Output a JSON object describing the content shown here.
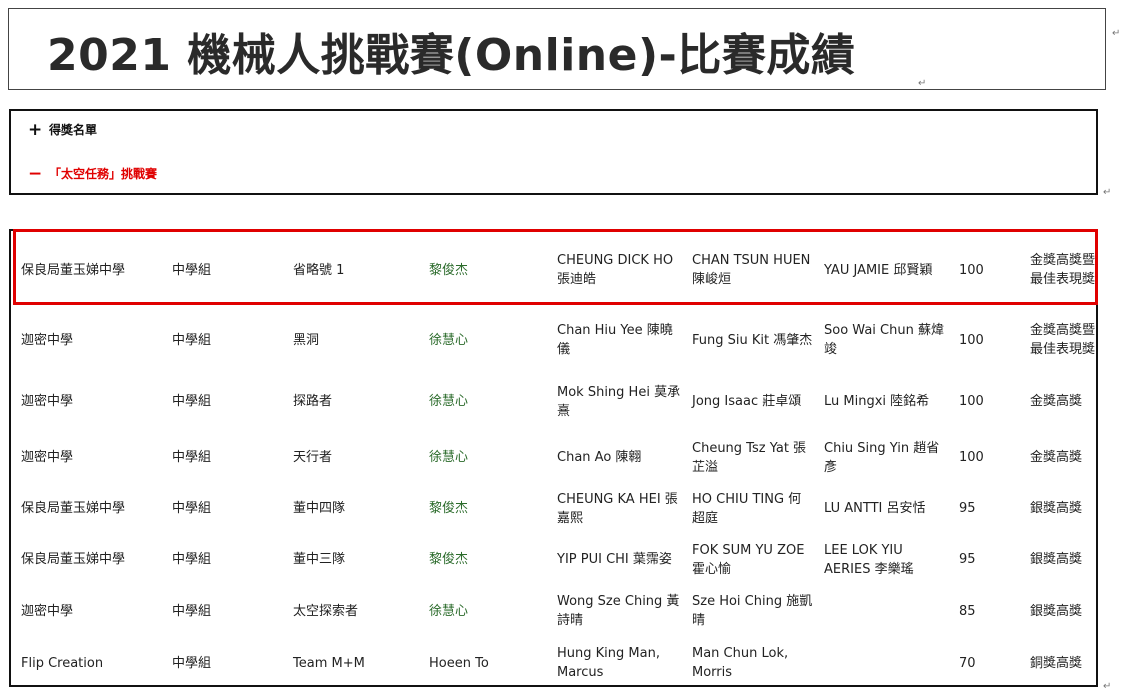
{
  "header": {
    "title": "2021 機械人挑戰賽(Online)-比賽成績",
    "para_mark": "↵"
  },
  "accordion": {
    "items": [
      {
        "sign": "+",
        "label": "得獎名單",
        "state": "collapsed"
      },
      {
        "sign": "−",
        "label": "「太空任務」挑戰賽",
        "state": "expanded",
        "color": "#e00000"
      }
    ]
  },
  "results_table": {
    "highlight_color": "#e00000",
    "rows": [
      {
        "school": "保良局董玉娣中學",
        "group": "中學組",
        "team": "省略號 1",
        "teacher": "黎俊杰",
        "member1": "CHEUNG DICK HO 張迪皓",
        "member2": "CHAN TSUN HUEN 陳峻烜",
        "member3": "YAU JAMIE 邱賢穎",
        "score": "100",
        "award": "金獎高獎暨 最佳表現獎"
      },
      {
        "school": "迦密中學",
        "group": "中學組",
        "team": "黑洞",
        "teacher": "徐慧心",
        "member1": "Chan Hiu Yee 陳曉儀",
        "member2": "Fung Siu Kit 馮肇杰",
        "member3": "Soo Wai Chun 蘇煒竣",
        "score": "100",
        "award": "金獎高獎暨 最佳表現獎"
      },
      {
        "school": "迦密中學",
        "group": "中學組",
        "team": "探路者",
        "teacher": "徐慧心",
        "member1": "Mok Shing Hei 莫承熹",
        "member2": "Jong Isaac 莊卓頌",
        "member3": "Lu Mingxi 陸銘希",
        "score": "100",
        "award": "金獎高獎"
      },
      {
        "school": "迦密中學",
        "group": "中學組",
        "team": "天行者",
        "teacher": "徐慧心",
        "member1": "Chan Ao 陳翱",
        "member2": "Cheung Tsz Yat 張芷溢",
        "member3": "Chiu Sing Yin 趙省彥",
        "score": "100",
        "award": "金獎高獎"
      },
      {
        "school": "保良局董玉娣中學",
        "group": "中學組",
        "team": "董中四隊",
        "teacher": "黎俊杰",
        "member1": "CHEUNG KA HEI 張嘉熙",
        "member2": "HO CHIU TING 何超庭",
        "member3": "LU ANTTI 呂安恬",
        "score": "95",
        "award": "銀獎高獎"
      },
      {
        "school": "保良局董玉娣中學",
        "group": "中學組",
        "team": "董中三隊",
        "teacher": "黎俊杰",
        "member1": "YIP PUI CHI 葉霈姿",
        "member2": "FOK SUM YU ZOE 霍心愉",
        "member3": "LEE LOK YIU AERIES 李樂瑤",
        "score": "95",
        "award": "銀獎高獎"
      },
      {
        "school": "迦密中學",
        "group": "中學組",
        "team": "太空探索者",
        "teacher": "徐慧心",
        "member1": "Wong Sze Ching 黃詩晴",
        "member2": "Sze Hoi Ching 施凱晴",
        "member3": "",
        "score": "85",
        "award": "銀獎高獎"
      },
      {
        "school": "Flip Creation",
        "group": "中學組",
        "team": "Team M+M",
        "teacher": "Hoeen To",
        "member1": "Hung King Man, Marcus",
        "member2": "Man Chun Lok, Morris",
        "member3": "",
        "score": "70",
        "award": "銅獎高獎"
      }
    ]
  }
}
